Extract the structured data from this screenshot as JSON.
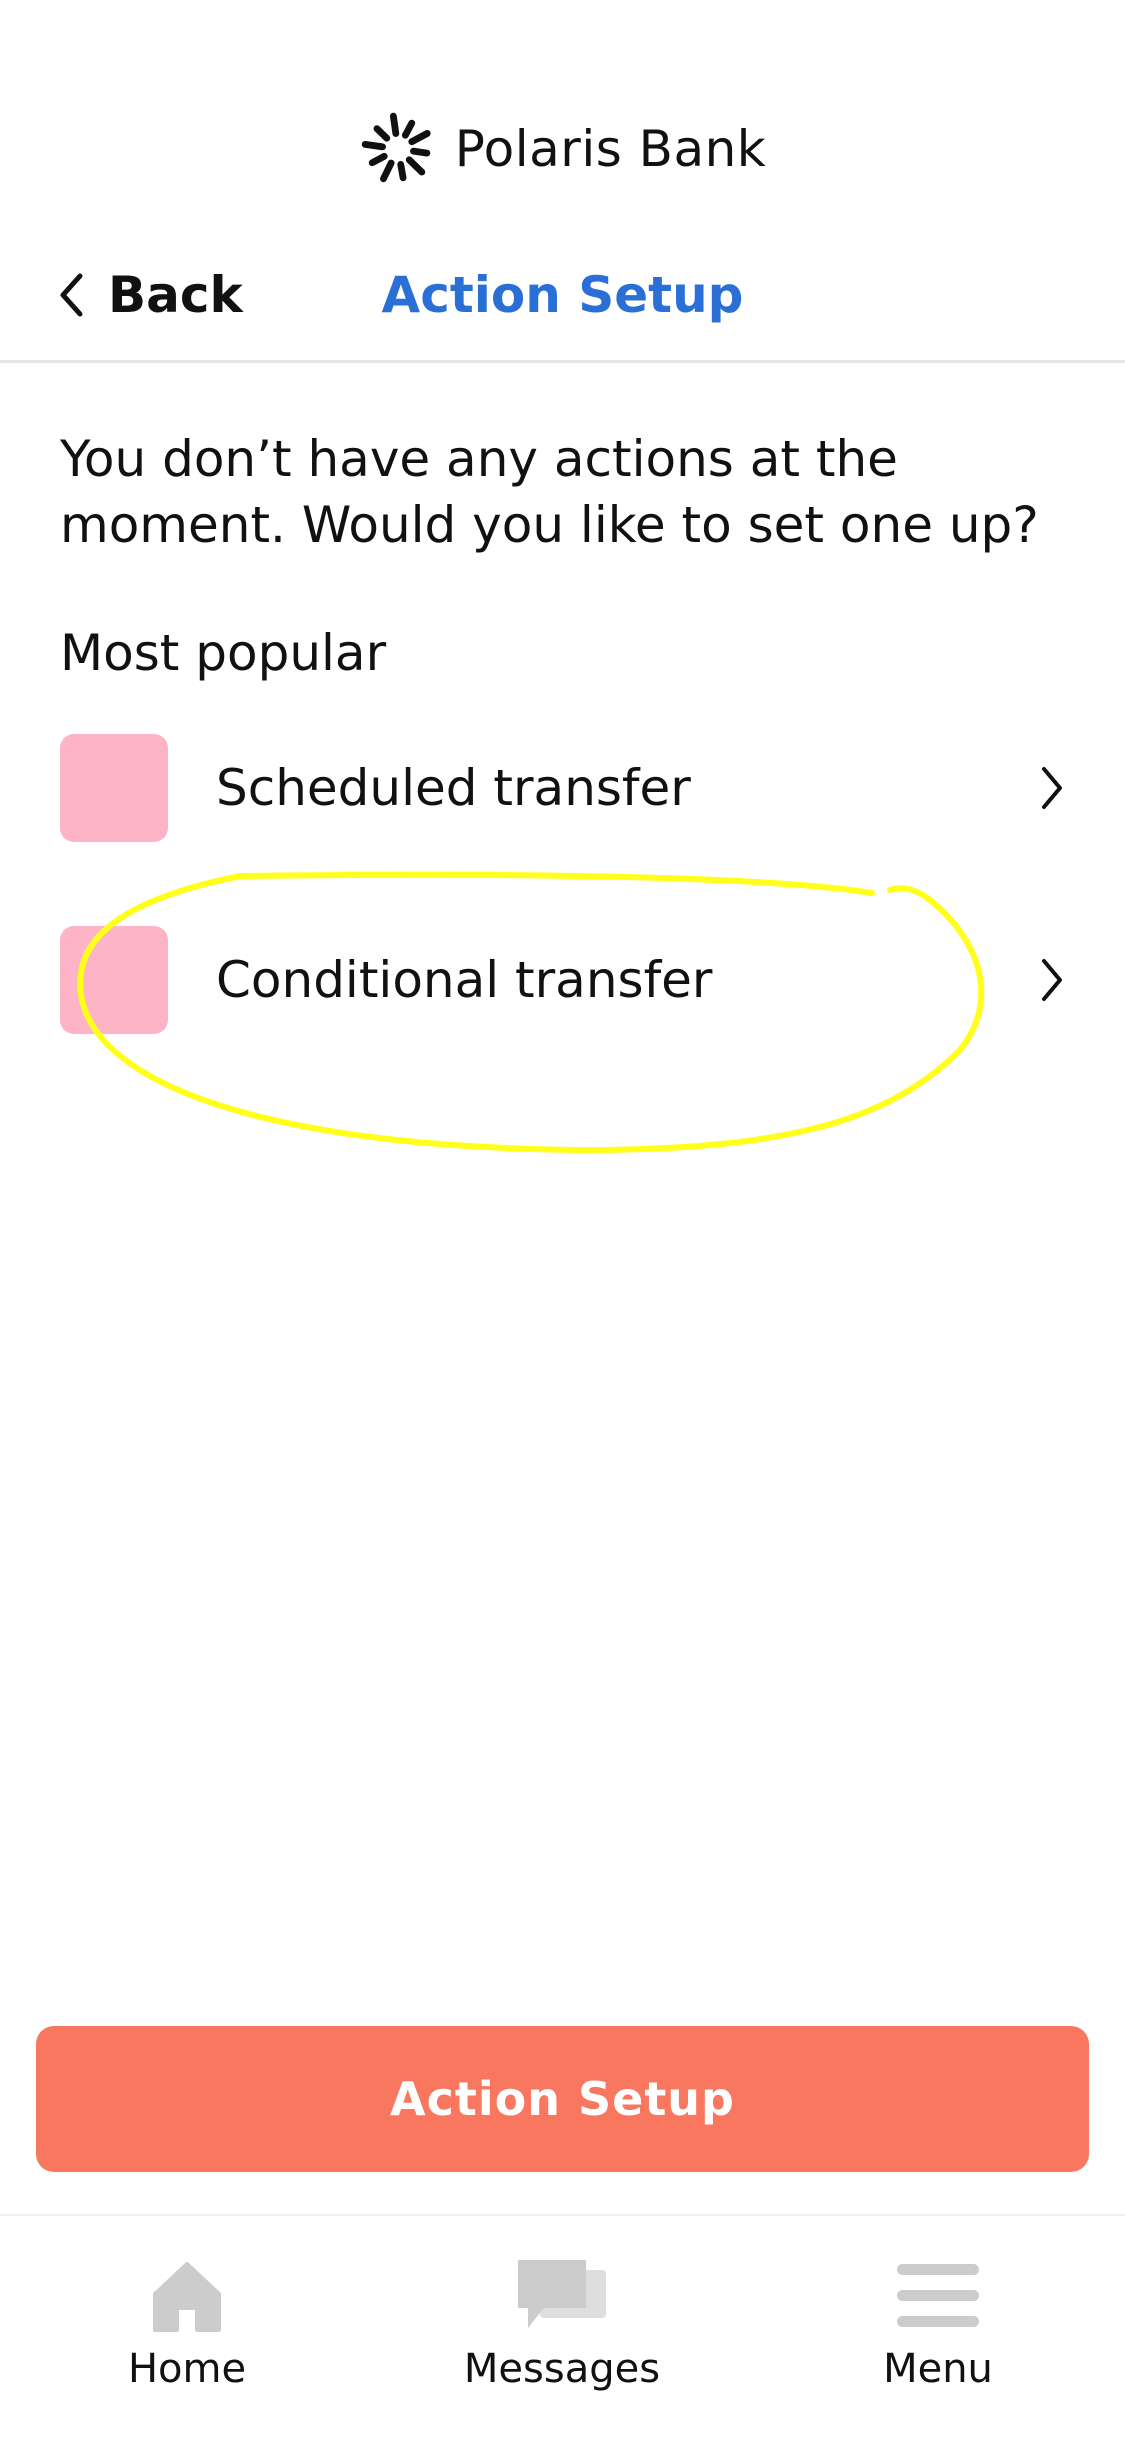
{
  "brand": {
    "name": "Polaris Bank",
    "logo_icon": "sunburst-logo-icon"
  },
  "nav": {
    "back_label": "Back",
    "back_icon": "chevron-left-icon",
    "title": "Action Setup",
    "title_color": "#2a6fd6"
  },
  "intro_text": "You don’t have any actions at the moment. Would you like to set one up?",
  "section_title": "Most popular",
  "actions": [
    {
      "label": "Scheduled transfer",
      "thumb_color": "#fdb4c6",
      "icon": "chevron-right-icon"
    },
    {
      "label": "Conditional transfer",
      "thumb_color": "#fdb4c6",
      "icon": "chevron-right-icon",
      "highlighted": true
    }
  ],
  "annotation": {
    "type": "hand-drawn-circle",
    "color": "#ffff1a",
    "target": "Conditional transfer"
  },
  "cta": {
    "label": "Action Setup",
    "color": "#f8775e"
  },
  "tabbar": {
    "tabs": [
      {
        "label": "Home",
        "icon": "home-icon"
      },
      {
        "label": "Messages",
        "icon": "messages-icon"
      },
      {
        "label": "Menu",
        "icon": "hamburger-menu-icon"
      }
    ]
  }
}
